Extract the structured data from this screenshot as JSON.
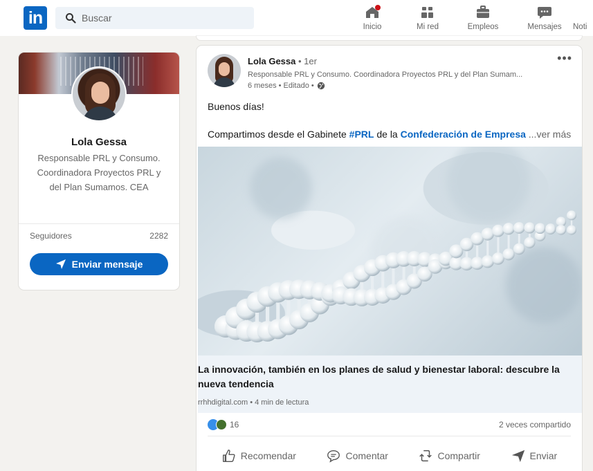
{
  "nav": {
    "logo": "in",
    "search_placeholder": "Buscar",
    "items": [
      {
        "label": "Inicio"
      },
      {
        "label": "Mi red"
      },
      {
        "label": "Empleos"
      },
      {
        "label": "Mensajes"
      },
      {
        "label": "Noti"
      }
    ]
  },
  "profile": {
    "name": "Lola Gessa",
    "headline": "Responsable PRL y Consumo. Coordinadora Proyectos PRL y del Plan Sumamos. CEA",
    "followers_label": "Seguidores",
    "followers_count": "2282",
    "message_button": "Enviar mensaje"
  },
  "post": {
    "author": "Lola Gessa",
    "degree": " • 1er",
    "headline": "Responsable PRL y Consumo. Coordinadora Proyectos PRL y del Plan Sumam...",
    "time": "6 meses • Editado •",
    "text1": "Buenos días!",
    "text2_prefix": "Compartimos desde el Gabinete ",
    "hashtag": "#PRL",
    "text2_mid": " de la ",
    "org_link": "Confederación de Empresa",
    "see_more": "...ver más",
    "article_title": "La innovación, también en los planes de salud y bienestar laboral: descubre la nueva tendencia",
    "article_meta": "rrhhdigital.com • 4 min de lectura",
    "reaction_count": "16",
    "shares": "2 veces compartido",
    "actions": [
      {
        "label": "Recomendar",
        "icon": "like-icon"
      },
      {
        "label": "Comentar",
        "icon": "comment-icon"
      },
      {
        "label": "Compartir",
        "icon": "share-icon"
      },
      {
        "label": "Enviar",
        "icon": "send-icon"
      }
    ]
  },
  "colors": {
    "brand": "#0a66c2",
    "background": "#f3f2ef",
    "link_card": "#eef3f8"
  }
}
